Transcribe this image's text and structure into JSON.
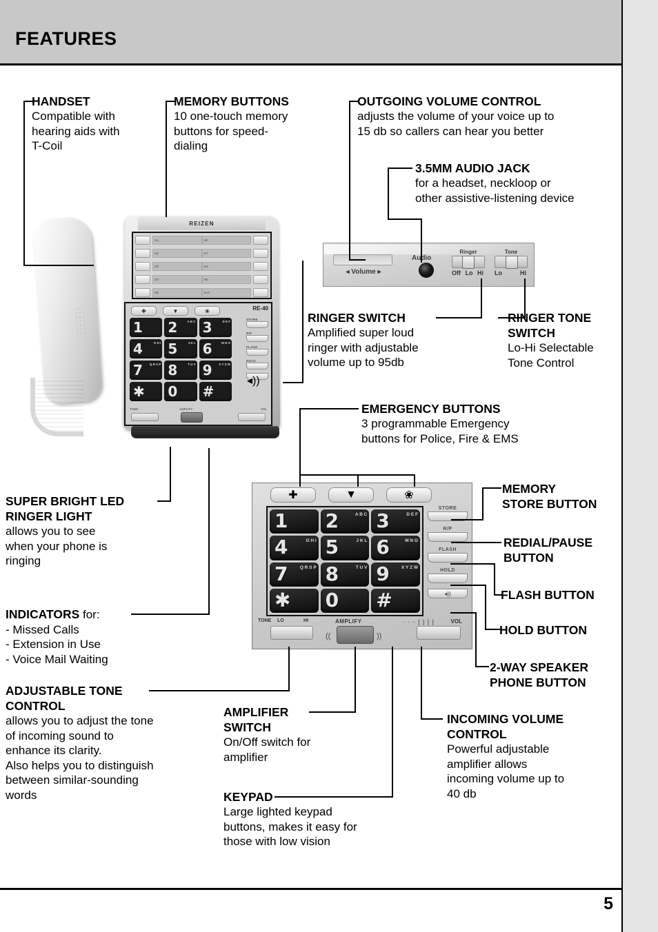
{
  "header": {
    "title": "FEATURES"
  },
  "footer": {
    "page_number": "5"
  },
  "callouts": {
    "handset": {
      "title": "HANDSET",
      "body": "Compatible with\nhearing aids with\nT-Coil"
    },
    "memory_buttons": {
      "title": "MEMORY BUTTONS",
      "body": "10 one-touch memory\nbuttons for speed-\ndialing"
    },
    "outgoing_volume": {
      "title": "OUTGOING VOLUME CONTROL",
      "body": "adjusts the volume of your voice up to\n15 db so callers can hear you better"
    },
    "audio_jack": {
      "title": "3.5MM AUDIO JACK",
      "body": "for a headset, neckloop or\nother assistive-listening device"
    },
    "ringer_switch": {
      "title": "RINGER SWITCH",
      "body": "Amplified super loud\nringer with adjustable\nvolume up to 95db"
    },
    "ringer_tone": {
      "title": "RINGER TONE\nSWITCH",
      "body": "Lo-Hi Selectable\nTone Control"
    },
    "emergency": {
      "title": "EMERGENCY BUTTONS",
      "body": "3 programmable Emergency\nbuttons for Police, Fire & EMS"
    },
    "led_light": {
      "title": "SUPER BRIGHT LED\nRINGER LIGHT",
      "body": "allows you to see\nwhen your phone is\nringing"
    },
    "indicators": {
      "title": "INDICATORS",
      "after_title": " for:",
      "body": "- Missed Calls\n- Extension in Use\n- Voice Mail Waiting"
    },
    "tone_control": {
      "title": "ADJUSTABLE TONE\nCONTROL",
      "body": "allows you to adjust the tone\nof incoming sound to\nenhance its clarity.\nAlso helps you to distinguish\nbetween similar-sounding\nwords"
    },
    "amplifier": {
      "title": "AMPLIFIER\nSWITCH",
      "body": "On/Off switch for\namplifier"
    },
    "keypad": {
      "title": "KEYPAD",
      "body": "Large lighted keypad\nbuttons, makes it easy for\nthose with low vision"
    },
    "memory_store": {
      "title": "MEMORY\nSTORE BUTTON",
      "body": ""
    },
    "redial_pause": {
      "title": "REDIAL/PAUSE\nBUTTON",
      "body": ""
    },
    "flash": {
      "title": "FLASH BUTTON",
      "body": ""
    },
    "hold": {
      "title": "HOLD BUTTON",
      "body": ""
    },
    "speakerphone": {
      "title": "2-WAY SPEAKER\nPHONE BUTTON",
      "body": ""
    },
    "incoming_volume": {
      "title": "INCOMING VOLUME\nCONTROL",
      "body": "Powerful adjustable\namplifier allows\nincoming volume up to\n40 db"
    }
  },
  "phone": {
    "brand": "REIZEN",
    "model": "RE-40",
    "memory_labels_left": [
      "M1",
      "M2",
      "M3",
      "M4",
      "M5"
    ],
    "memory_labels_right": [
      "M6",
      "M7",
      "M8",
      "M9",
      "M10"
    ],
    "keypad": [
      {
        "digit": "1",
        "letters": ""
      },
      {
        "digit": "2",
        "letters": "A\nB\nC"
      },
      {
        "digit": "3",
        "letters": "D\nE\nF"
      },
      {
        "digit": "4",
        "letters": "G\nH\nI"
      },
      {
        "digit": "5",
        "letters": "J\nK\nL"
      },
      {
        "digit": "6",
        "letters": "M\nN\nO"
      },
      {
        "digit": "7",
        "letters": "Q\nR\nS\nP"
      },
      {
        "digit": "8",
        "letters": "T\nU\nV"
      },
      {
        "digit": "9",
        "letters": "X\nY\nZ\nW"
      },
      {
        "digit": "✱",
        "letters": ""
      },
      {
        "digit": "0",
        "letters": ""
      },
      {
        "digit": "#",
        "letters": ""
      }
    ],
    "side_buttons": [
      {
        "label": "STORE",
        "glyph": ""
      },
      {
        "label": "R/P",
        "glyph": ""
      },
      {
        "label": "FLASH",
        "glyph": ""
      },
      {
        "label": "HOLD",
        "glyph": ""
      },
      {
        "label": "",
        "glyph": "◂))"
      }
    ],
    "emergency_glyphs": [
      "✚",
      "▼",
      "❀"
    ],
    "tone_label": "TONE",
    "tone_lo": "LO",
    "tone_hi": "HI",
    "amplify_label": "AMPLIFY",
    "vol_label": "VOL",
    "vol_ticks": "· · · | | | |",
    "speaker_left": "((",
    "speaker_right": "))"
  },
  "side_panel": {
    "volume_label": "◂ Volume ▸",
    "audio_label": "Audio",
    "ringer_label": "Ringer",
    "ringer_positions": [
      "Off",
      "Lo",
      "Hi"
    ],
    "tone_label": "Tone",
    "tone_positions": [
      "Lo",
      "Hi"
    ]
  }
}
